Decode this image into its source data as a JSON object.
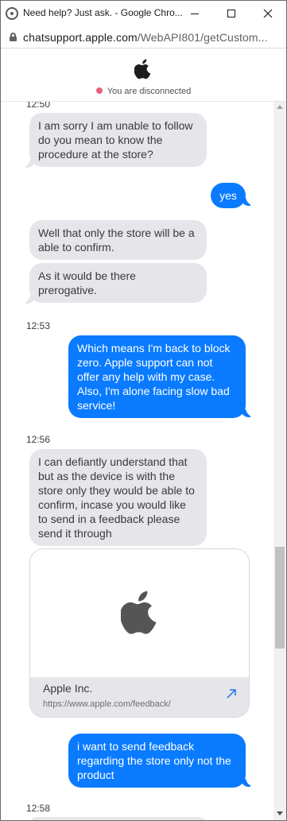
{
  "window": {
    "title": "Need help? Just ask. - Google Chro...",
    "icon": "chrome-icon"
  },
  "address_bar": {
    "domain": "chatsupport.apple.com",
    "path": "/WebAPI801/getCustom..."
  },
  "chat_header": {
    "logo": "apple-logo-icon",
    "status_text": "You are disconnected",
    "status_color": "#e8607a"
  },
  "colors": {
    "incoming_bubble": "#e5e5ea",
    "outgoing_bubble": "#0a7bff"
  },
  "messages": {
    "ts_partial": "12:50",
    "m1": "I am sorry I am unable to follow\ndo you mean to know the\nprocedure at the store?",
    "m2": "yes",
    "m3": "Well that only the store will be a\nable to confirm.",
    "m4": "As it would be there\nprerogative.",
    "ts_1253": "12:53",
    "m5": "Which means I'm back to block\nzero. Apple support can not\noffer any help with my case.\nAlso, I'm alone facing slow bad\nservice!",
    "ts_1256": "12:56",
    "m6": "I can defiantly understand that\nbut as the device is with the\nstore only they would be able to\nconfirm, incase you would like\nto send in a feedback please\nsend it through",
    "m7": "i want to send feedback\nregarding the store only not the\nproduct",
    "ts_1258": "12:58"
  },
  "link_card": {
    "title": "Apple Inc.",
    "url": "https://www.apple.com/feedback/",
    "image": "apple-logo-icon",
    "action_icon": "external-link-arrow-icon"
  }
}
